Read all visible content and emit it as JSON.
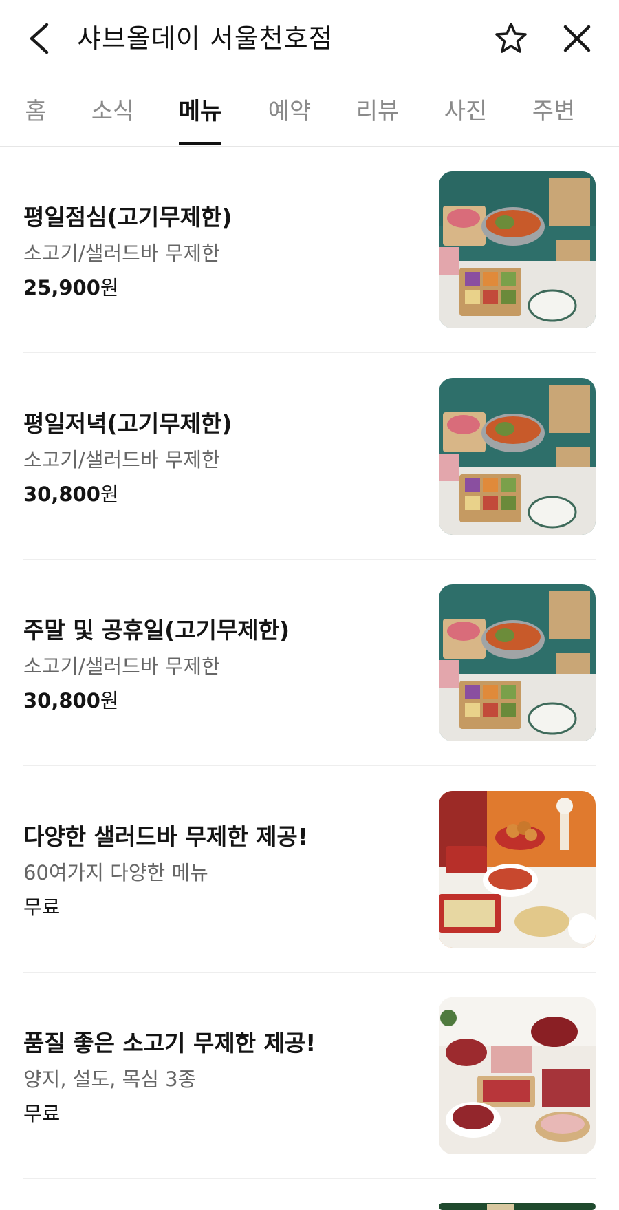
{
  "header": {
    "title": "샤브올데이 서울천호점",
    "icons": {
      "back": "chevron-left-icon",
      "favorite": "star-outline-icon",
      "close": "close-icon"
    }
  },
  "tabs": [
    {
      "label": "홈"
    },
    {
      "label": "소식"
    },
    {
      "label": "메뉴",
      "active": true
    },
    {
      "label": "예약"
    },
    {
      "label": "리뷰"
    },
    {
      "label": "사진"
    },
    {
      "label": "주변"
    }
  ],
  "menu": [
    {
      "name": "평일점심(고기무제한)",
      "desc": "소고기/샐러드바 무제한",
      "price": "25,900",
      "unit": "원",
      "image": "shabu-hotpot-spread"
    },
    {
      "name": "평일저녁(고기무제한)",
      "desc": "소고기/샐러드바 무제한",
      "price": "30,800",
      "unit": "원",
      "image": "shabu-hotpot-spread"
    },
    {
      "name": "주말 및 공휴일(고기무제한)",
      "desc": "소고기/샐러드바 무제한",
      "price": "30,800",
      "unit": "원",
      "image": "shabu-hotpot-spread"
    },
    {
      "name": "다양한 샐러드바 무제한 제공!",
      "desc": "60여가지 다양한 메뉴",
      "price": "무료",
      "unit": "",
      "image": "salad-bar-spread"
    },
    {
      "name": "품질 좋은 소고기 무제한 제공!",
      "desc": "양지, 설도, 목심 3종",
      "price": "무료",
      "unit": "",
      "image": "raw-beef-platter"
    }
  ],
  "colors": {
    "accent_text": "#111111",
    "inactive_tab": "#8a8a8a",
    "description": "#666666",
    "divider": "#eeeeee",
    "thumb_teal": "#2e6f6a",
    "thumb_orange": "#e07a2e"
  }
}
